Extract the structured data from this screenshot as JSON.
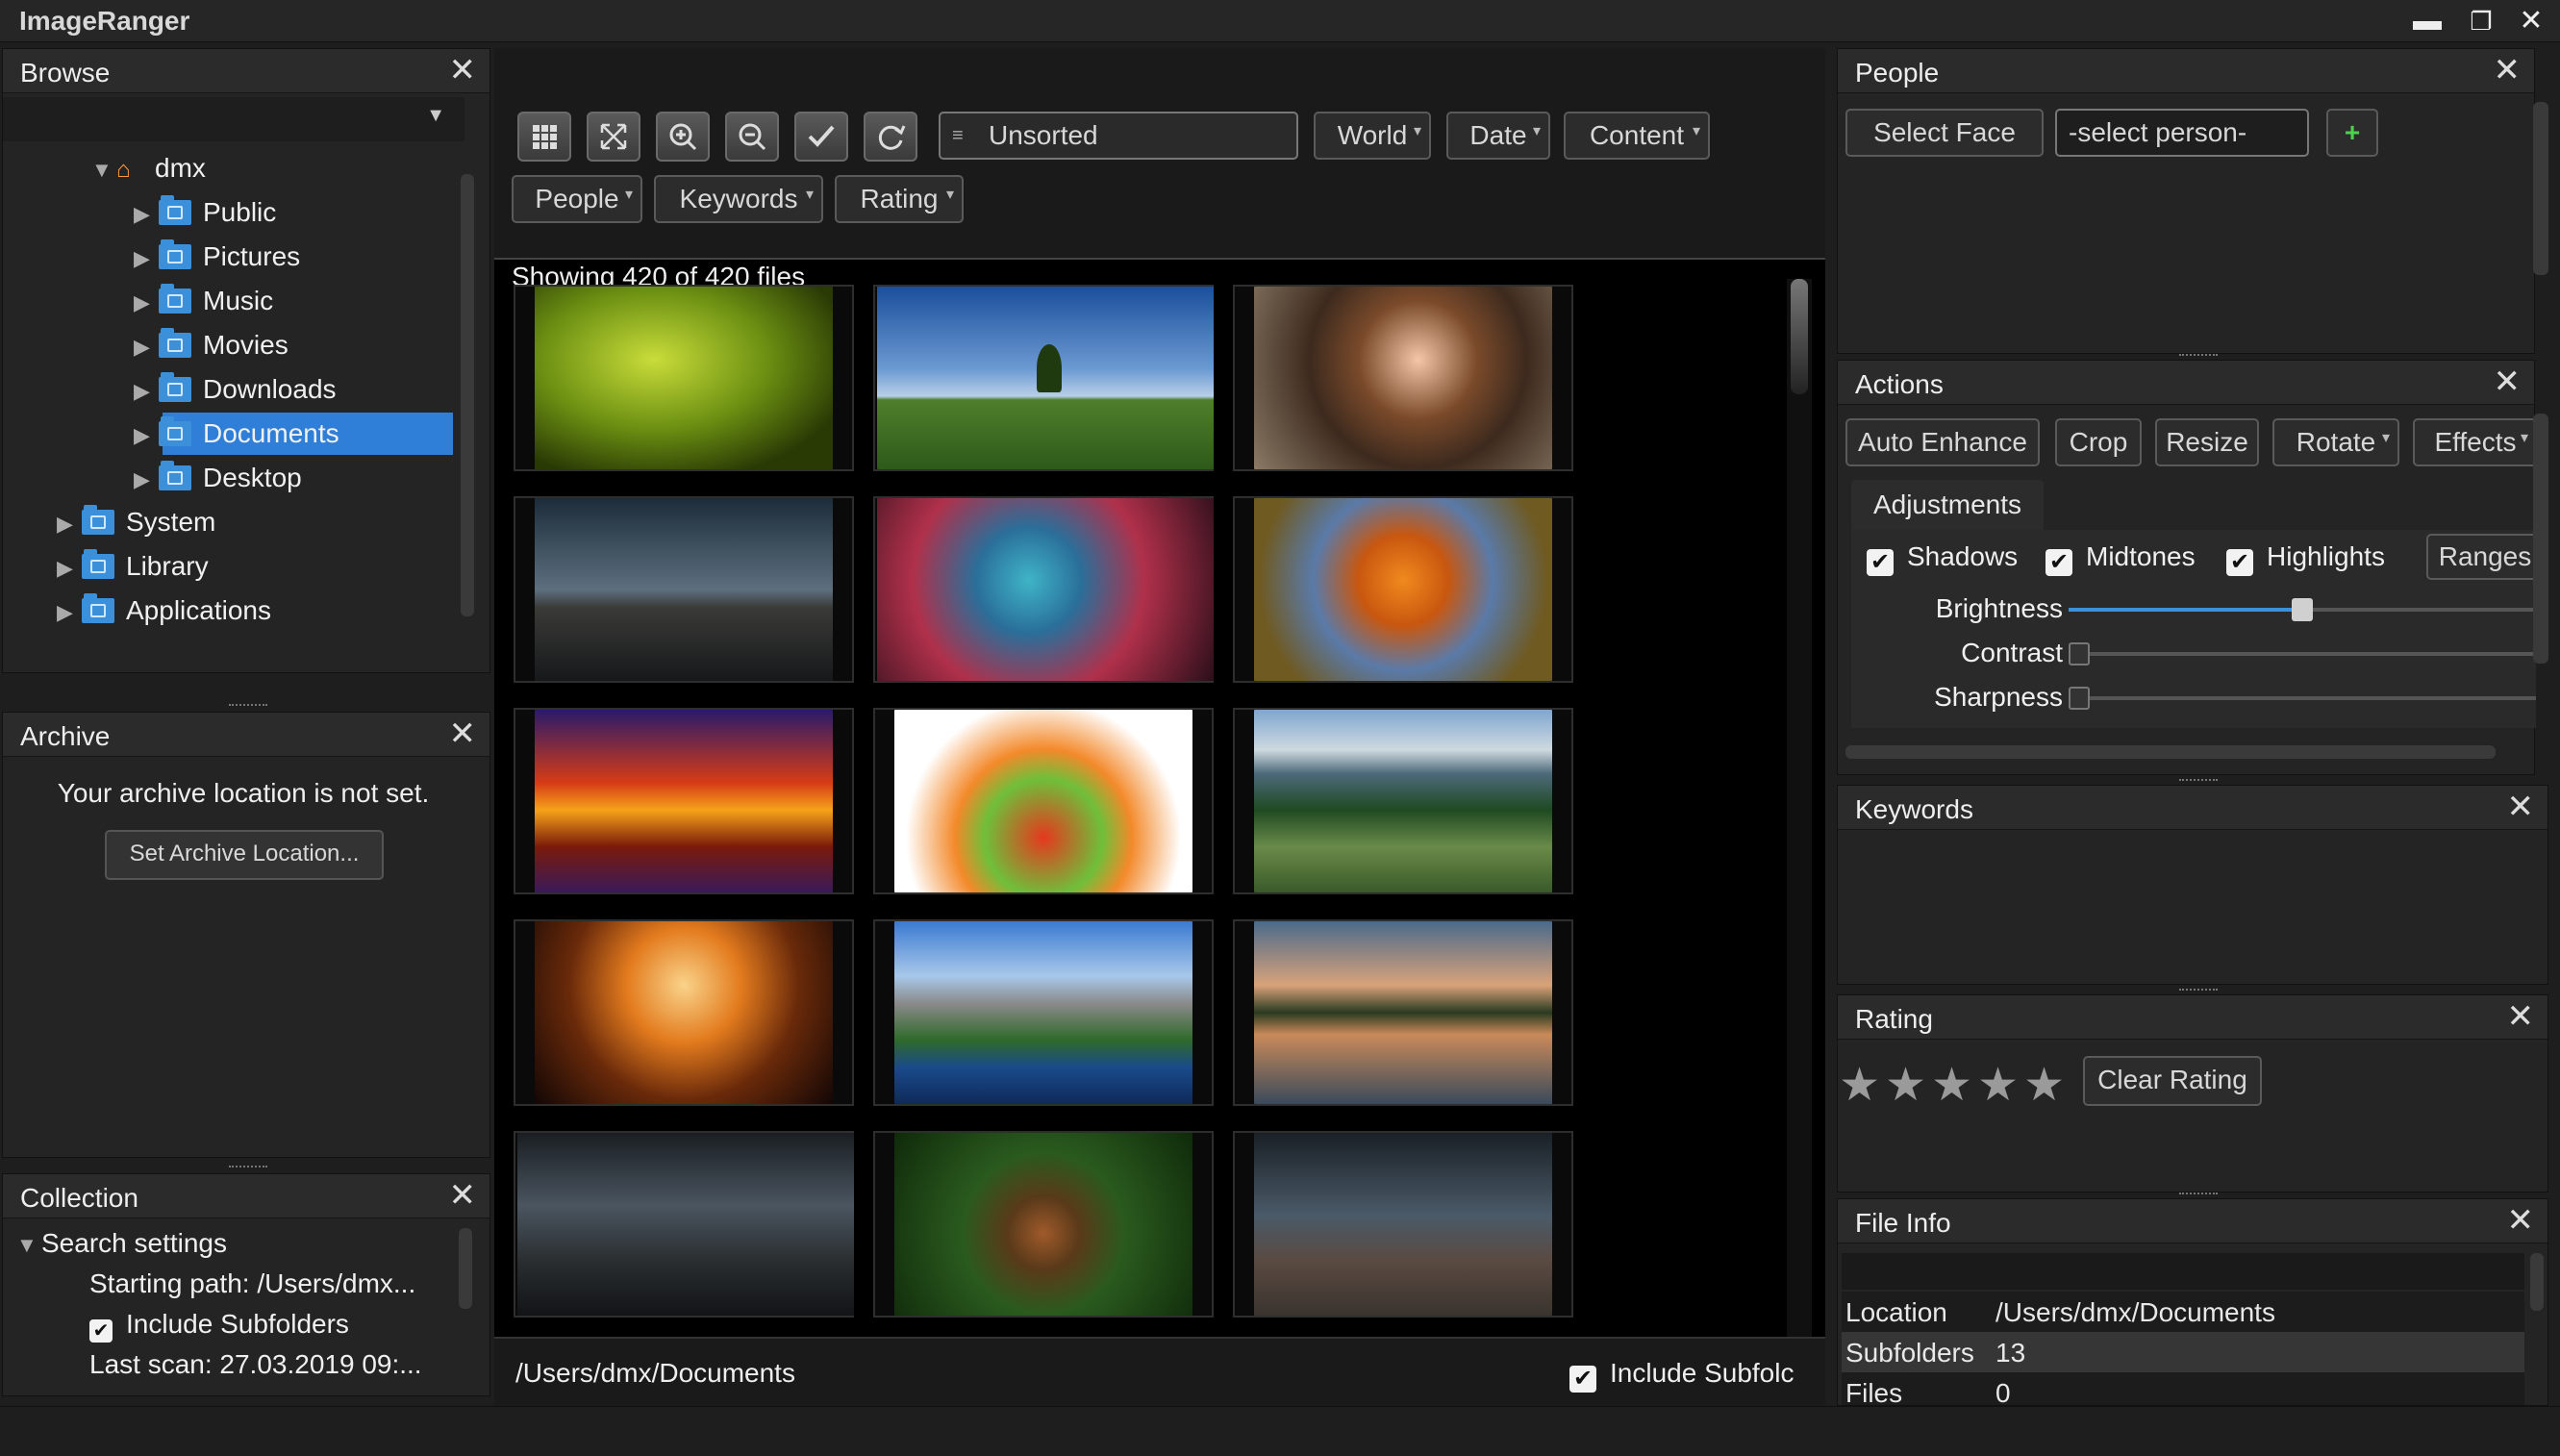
{
  "app": {
    "title": "ImageRanger"
  },
  "browse": {
    "title": "Browse",
    "tree": [
      {
        "label": "dmx",
        "icon": "home-icon"
      },
      {
        "label": "Public"
      },
      {
        "label": "Pictures"
      },
      {
        "label": "Music"
      },
      {
        "label": "Movies"
      },
      {
        "label": "Downloads"
      },
      {
        "label": "Documents",
        "selected": true
      },
      {
        "label": "Desktop"
      },
      {
        "label": "System"
      },
      {
        "label": "Library"
      },
      {
        "label": "Applications"
      }
    ]
  },
  "archive": {
    "title": "Archive",
    "message": "Your archive location is not set.",
    "button": "Set Archive Location..."
  },
  "collection": {
    "title": "Collection",
    "search_settings": "Search settings",
    "starting_path": "Starting path: /Users/dmx...",
    "include_subfolders": "Include Subfolders",
    "last_scan": "Last scan: 27.03.2019 09:..."
  },
  "toolbar": {
    "sort": "Unsorted",
    "filters": [
      "World",
      "Date",
      "Content",
      "People",
      "Keywords",
      "Rating"
    ]
  },
  "grid": {
    "status": "Showing 420 of 420 files",
    "path": "/Users/dmx/Documents",
    "include_subfolders": "Include Subfolc"
  },
  "people": {
    "title": "People",
    "select_face": "Select Face",
    "select_person": "-select person-",
    "add": "+"
  },
  "actions": {
    "title": "Actions",
    "buttons": [
      "Auto Enhance",
      "Crop",
      "Resize",
      "Rotate",
      "Effects"
    ],
    "adjustments_tab": "Adjustments",
    "checks": [
      "Shadows",
      "Midtones",
      "Highlights"
    ],
    "ranges": "Ranges",
    "sliders": [
      {
        "label": "Brightness",
        "value": 0.5
      },
      {
        "label": "Contrast",
        "value": 0
      },
      {
        "label": "Sharpness",
        "value": 0
      }
    ]
  },
  "keywords": {
    "title": "Keywords"
  },
  "rating": {
    "title": "Rating",
    "clear": "Clear Rating",
    "stars": 5
  },
  "fileinfo": {
    "title": "File Info",
    "rows": [
      {
        "key": "Location",
        "value": "/Users/dmx/Documents"
      },
      {
        "key": "Subfolders",
        "value": "13"
      },
      {
        "key": "Files",
        "value": "0"
      }
    ]
  },
  "colors": {
    "accent": "#2f7fd8",
    "selected": "#2f7fd8",
    "panel": "#242424",
    "grid_bg": "#000000"
  }
}
